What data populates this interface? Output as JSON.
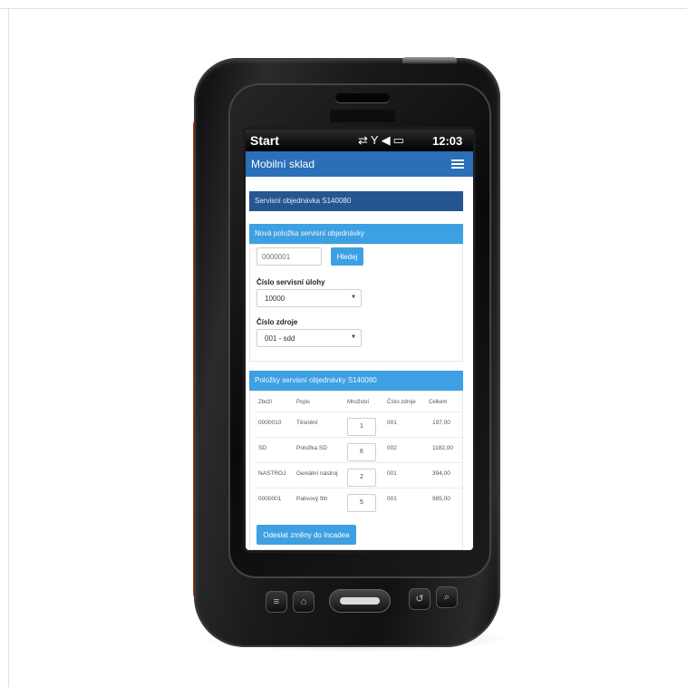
{
  "status_bar": {
    "start_label": "Start",
    "icons": [
      "connectivity-icon",
      "signal-icon",
      "volume-icon",
      "battery-icon"
    ],
    "time": "12:03"
  },
  "app_bar": {
    "title": "Mobilní sklad",
    "menu_icon": "hamburger-icon"
  },
  "order_header": {
    "title": "Servisní objednávka S140080"
  },
  "new_item_panel": {
    "title": "Nová položka servisní objednávky",
    "code_input": {
      "placeholder": "0000001"
    },
    "search_button_label": "Hledej",
    "task_label": "Číslo servisní úlohy",
    "task_value": "10000",
    "source_label": "Číslo zdroje",
    "source_value": "001 - sdd"
  },
  "items_panel": {
    "title": "Položky servisní objednávky S140080",
    "columns": [
      "Zboží",
      "Popis",
      "Množství",
      "Číslo zdroje",
      "Celkem"
    ],
    "rows": [
      {
        "item": "0000010",
        "description": "Těsnění",
        "quantity": "1",
        "source": "001",
        "total": "197,00"
      },
      {
        "item": "SD",
        "description": "Položka SD",
        "quantity": "6",
        "source": "002",
        "total": "1182,00"
      },
      {
        "item": "NASTROJ",
        "description": "Geniální nástroj",
        "quantity": "2",
        "source": "001",
        "total": "394,00"
      },
      {
        "item": "0000001",
        "description": "Palivový filtr",
        "quantity": "5",
        "source": "001",
        "total": "985,00"
      }
    ],
    "send_button_label": "Odeslat změny do Incadea"
  },
  "hardware_buttons": [
    "menu-icon",
    "home-icon",
    "navigation-pad",
    "back-icon",
    "search-icon"
  ],
  "colors": {
    "device_accent": "#ff5a12",
    "app_bar": "#2a6fb8",
    "panel_dark": "#25568f",
    "panel_blue": "#3da0e2"
  }
}
